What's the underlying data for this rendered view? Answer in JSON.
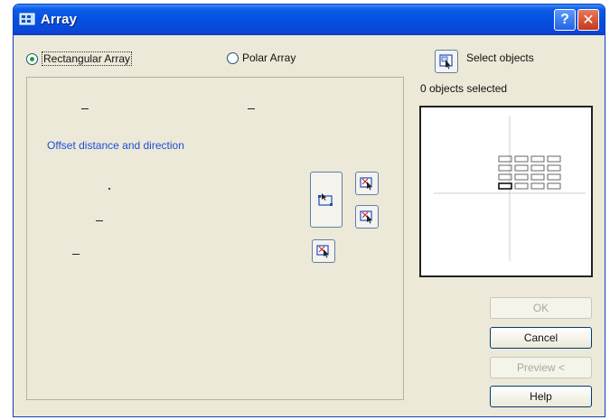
{
  "window": {
    "title": "Array",
    "help_button": "?",
    "close_button": "✕"
  },
  "mode": {
    "rectangular_label": "Rectangular Array",
    "polar_label": "Polar Array",
    "selected": "rectangular"
  },
  "panel": {
    "offset_label": "Offset distance and direction"
  },
  "selection": {
    "select_label": "Select objects",
    "count_text": "0 objects selected"
  },
  "buttons": {
    "ok": "OK",
    "cancel": "Cancel",
    "preview": "Preview <",
    "help": "Help"
  },
  "icons": {
    "app": "array-app-icon",
    "select": "select-objects-icon",
    "pick_both": "pick-both-offsets-icon",
    "pick": "pick-offset-icon"
  },
  "colors": {
    "titlebar": "#0450e0",
    "section_label": "#1d4ed8",
    "dialog_bg": "#ece9d8"
  },
  "preview_grid": {
    "rows": 4,
    "columns": 4
  }
}
